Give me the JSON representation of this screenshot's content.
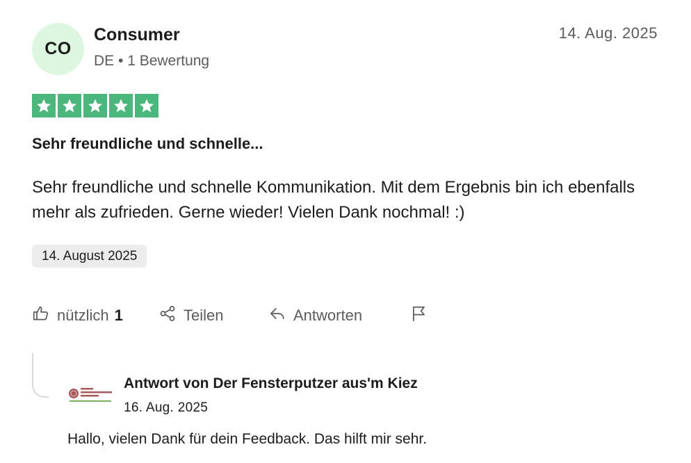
{
  "review": {
    "author": {
      "initials": "CO",
      "name": "Consumer",
      "meta": "DE • 1 Bewertung"
    },
    "date_short": "14. Aug. 2025",
    "rating": {
      "value": 5,
      "max": 5,
      "color": "#4cb77c"
    },
    "title": "Sehr freundliche und schnelle...",
    "text": "Sehr freundliche und schnelle Kommunikation. Mit dem Ergebnis bin ich ebenfalls mehr als zufrieden. Gerne wieder! Vielen Dank nochmal! :)",
    "experience_date": "14. August 2025",
    "actions": {
      "useful_label": "nützlich",
      "useful_count": "1",
      "share_label": "Teilen",
      "reply_label": "Antworten",
      "flag_icon": "flag-icon"
    }
  },
  "company_reply": {
    "logo_icon": "company-logo",
    "title": "Antwort von Der Fensterputzer aus'm Kiez",
    "date": "16. Aug. 2025",
    "text": "Hallo, vielen Dank für dein Feedback. Das hilft mir sehr."
  },
  "colors": {
    "avatar_bg": "#dcf6df",
    "star_green": "#4cb77c",
    "muted_text": "#5b5b5b",
    "chip_bg": "#ececec"
  }
}
